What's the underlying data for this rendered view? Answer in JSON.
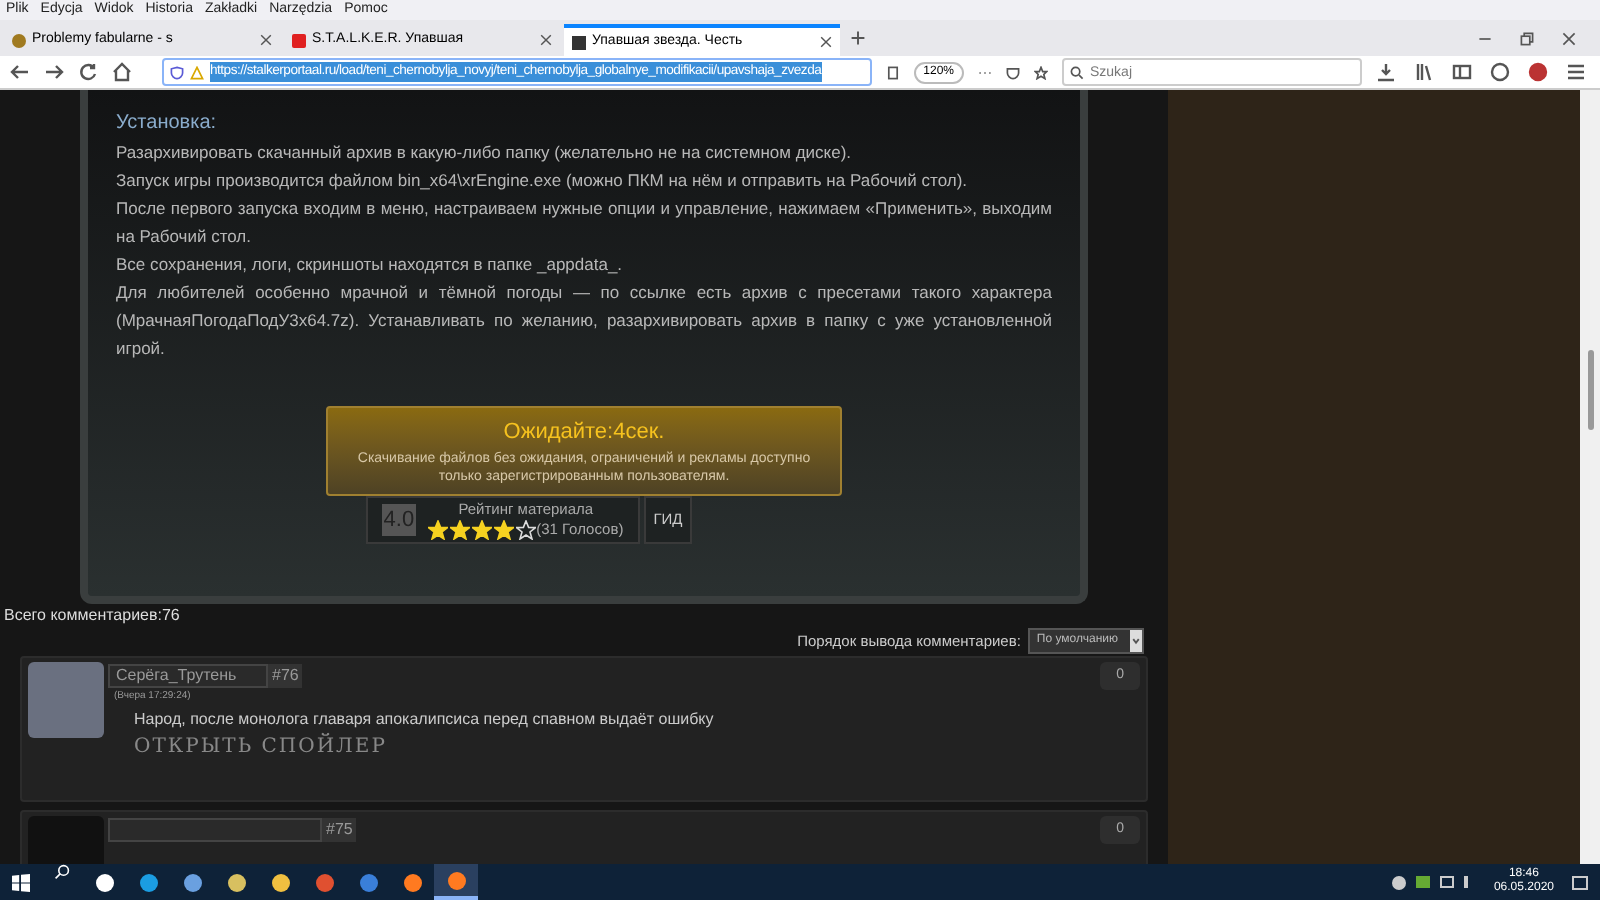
{
  "menu": [
    "Plik",
    "Edycja",
    "Widok",
    "Historia",
    "Zakładki",
    "Narzędzia",
    "Pomoc"
  ],
  "tabs": [
    {
      "label": "Problemy fabularne - s",
      "selected": false
    },
    {
      "label": "S.T.A.L.K.E.R. Упавшая",
      "selected": false
    },
    {
      "label": "Упавшая звезда. Честь",
      "selected": true
    }
  ],
  "address": {
    "url": "https://stalkerportaal.ru/load/teni_chernobylja_novyj/teni_chernobylja_globalnye_modifikacii/upavshaja_zvezda",
    "zoom": "120%"
  },
  "search": {
    "placeholder": "Szukaj"
  },
  "article": {
    "heading": "Установка:",
    "paragraphs": [
      "Разархивировать скачанный архив в какую-либо папку (желательно не на системном диске).",
      "Запуск игры производится файлом bin_x64\\xrEngine.exe (можно ПКМ на нём и отправить на Рабочий стол).",
      "После первого запуска входим в меню, настраиваем нужные опции и управление, нажимаем «Применить», выходим на Рабочий стол.",
      "Все сохранения, логи, скриншоты находятся в папке _appdata_.",
      "Для любителей особенно мрачной и тёмной погоды — по ссылке есть архив с пресетами такого характера (МрачнаяПогодаПодУ3х64.7z). Устанавливать по желанию, разархивировать архив в папку с уже установленной игрой."
    ]
  },
  "download": {
    "title": "Ожидайте:4сек.",
    "note": "Скачивание файлов без ожидания, ограничений и рекламы доступно только зарегистрированным пользователям."
  },
  "rating": {
    "score": "4.0",
    "label": "Рейтинг материала",
    "stars": 4,
    "votes": "(31 Голосов)",
    "guide": "ГИД"
  },
  "comments_total": "Всего комментариев:76",
  "order": {
    "label": "Порядок вывода комментариев:",
    "value": "По умолчанию"
  },
  "comments": [
    {
      "author": "Серёга_Трутень",
      "number": "#76",
      "time": "(Вчера 17:29:24)",
      "text": "Народ, после монолога главаря апокалипсиса перед спавном выдаёт ошибку",
      "spoiler": "ОТКРЫТЬ СПОЙЛЕР",
      "score": "0"
    },
    {
      "number": "#75",
      "score": "0"
    }
  ],
  "taskbar": {
    "time": "18:46",
    "date": "06.05.2020"
  }
}
